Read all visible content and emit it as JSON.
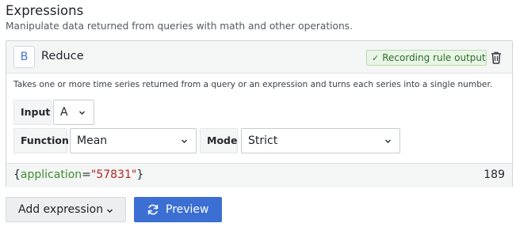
{
  "section": {
    "title": "Expressions",
    "description": "Manipulate data returned from queries with math and other operations."
  },
  "expression": {
    "ref_id": "B",
    "type": "Reduce",
    "recording_badge": "Recording rule output",
    "description": "Takes one or more time series returned from a query or an expression and turns each series into a single number.",
    "input": {
      "label": "Input",
      "value": "A"
    },
    "function": {
      "label": "Function",
      "value": "Mean"
    },
    "mode": {
      "label": "Mode",
      "value": "Strict"
    },
    "result": {
      "open_brace": "{",
      "label_key": "application",
      "equals": "=",
      "label_value": "\"57831\"",
      "close_brace": "}",
      "value": "189"
    }
  },
  "actions": {
    "add_expression": "Add expression",
    "preview": "Preview"
  },
  "icons": {
    "check": "check-icon",
    "trash": "trash-icon",
    "chevron": "chevron-down-icon",
    "refresh": "refresh-icon"
  },
  "colors": {
    "primary_button": "#3c6fd4",
    "recording_badge_bg": "#e9f5e6",
    "label_key": "#3e8d2f",
    "label_value": "#b2251f"
  }
}
